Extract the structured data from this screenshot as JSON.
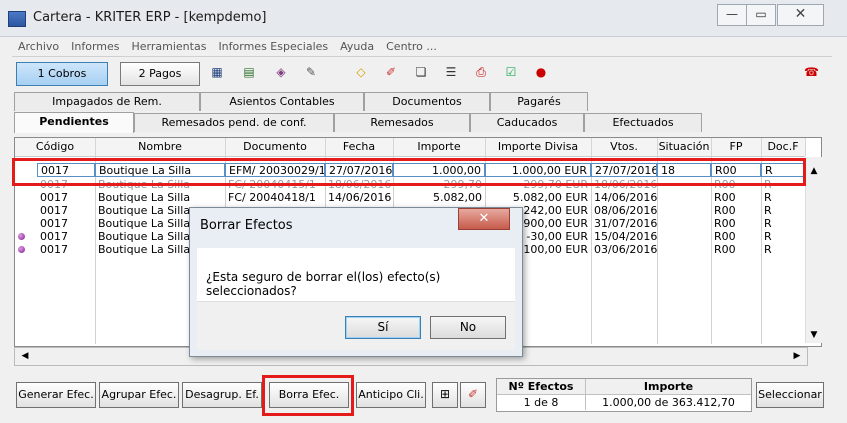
{
  "window": {
    "title": "Cartera - KRITER ERP - [kempdemo]",
    "min_glyph": "—",
    "max_glyph": "▭",
    "close_glyph": "✕"
  },
  "menu": [
    "Archivo",
    "Informes",
    "Herramientas",
    "Informes Especiales",
    "Ayuda",
    "Centro ..."
  ],
  "toolbar": {
    "cobros_label": "1 Cobros",
    "pagos_label": "2 Pagos",
    "icons": [
      "calculator-icon",
      "chart-icon",
      "stamp-icon",
      "edit-icon",
      "eraser-icon",
      "wand-icon",
      "cards-icon",
      "list-icon",
      "printer-icon",
      "checklist-icon",
      "bullet-icon"
    ]
  },
  "tabs_row1": [
    "Impagados de Rem.",
    "Asientos Contables",
    "Documentos",
    "Pagarés"
  ],
  "tabs_row2": [
    "Pendientes",
    "Remesados pend. de conf.",
    "Remesados",
    "Caducados",
    "Efectuados"
  ],
  "grid": {
    "columns": [
      "Código",
      "Nombre",
      "Documento",
      "Fecha",
      "Importe",
      "Importe Divisa",
      "Vtos.",
      "Situación",
      "FP",
      "Doc.F"
    ],
    "rows": [
      {
        "codigo": "0017",
        "nombre": "Boutique La Silla",
        "documento": "EFM/ 20030029/1",
        "fecha": "27/07/2016",
        "importe": "1.000,00",
        "divisa": "1.000,00 EUR",
        "vtos": "27/07/2016",
        "situacion": "18",
        "fp": "R00",
        "docf": "R"
      },
      {
        "codigo": "0017",
        "nombre": "Boutique La Silla",
        "documento": "FC/ 20040415/1",
        "fecha": "18/06/2016",
        "importe": "299,70",
        "divisa": "299,70 EUR",
        "vtos": "18/06/2016",
        "situacion": "",
        "fp": "R00",
        "docf": "R"
      },
      {
        "codigo": "0017",
        "nombre": "Boutique La Silla",
        "documento": "FC/ 20040418/1",
        "fecha": "14/06/2016",
        "importe": "5.082,00",
        "divisa": "5.082,00 EUR",
        "vtos": "14/06/2016",
        "situacion": "",
        "fp": "R00",
        "docf": "R"
      },
      {
        "codigo": "0017",
        "nombre": "Boutique La Silla",
        "documento": "",
        "fecha": "",
        "importe": "",
        "divisa": "242,00 EUR",
        "vtos": "08/06/2016",
        "situacion": "",
        "fp": "R00",
        "docf": "R"
      },
      {
        "codigo": "0017",
        "nombre": "Boutique La Silla",
        "documento": "",
        "fecha": "",
        "importe": "",
        "divisa": "900,00 EUR",
        "vtos": "31/07/2016",
        "situacion": "",
        "fp": "R00",
        "docf": "R"
      },
      {
        "codigo": "0017",
        "nombre": "Boutique La Silla",
        "documento": "",
        "fecha": "",
        "importe": "",
        "divisa": "-30,00 EUR",
        "vtos": "15/04/2016",
        "situacion": "",
        "fp": "R00",
        "docf": "R"
      },
      {
        "codigo": "0017",
        "nombre": "Boutique La Silla",
        "documento": "",
        "fecha": "",
        "importe": "",
        "divisa": "-100,00 EUR",
        "vtos": "03/06/2016",
        "situacion": "",
        "fp": "R00",
        "docf": "R"
      }
    ]
  },
  "dialog": {
    "title": "Borrar Efectos",
    "message": "¿Esta seguro de borrar el(los) efecto(s) seleccionados?",
    "yes_label": "Sí",
    "no_label": "No",
    "close_glyph": "✕"
  },
  "bottom": {
    "generar": "Generar Efec.",
    "agrupar": "Agrupar Efec.",
    "desagrupar": "Desagrup. Ef.",
    "borrar": "Borra Efec.",
    "anticipo": "Anticipo Cli.",
    "seleccionar": "Seleccionar"
  },
  "summary": {
    "efectos_header": "Nº Efectos",
    "importe_header": "Importe",
    "efectos_value": "1 de 8",
    "importe_value": "1.000,00 de 363.412,70"
  },
  "highlight_color": "#e31b1b"
}
